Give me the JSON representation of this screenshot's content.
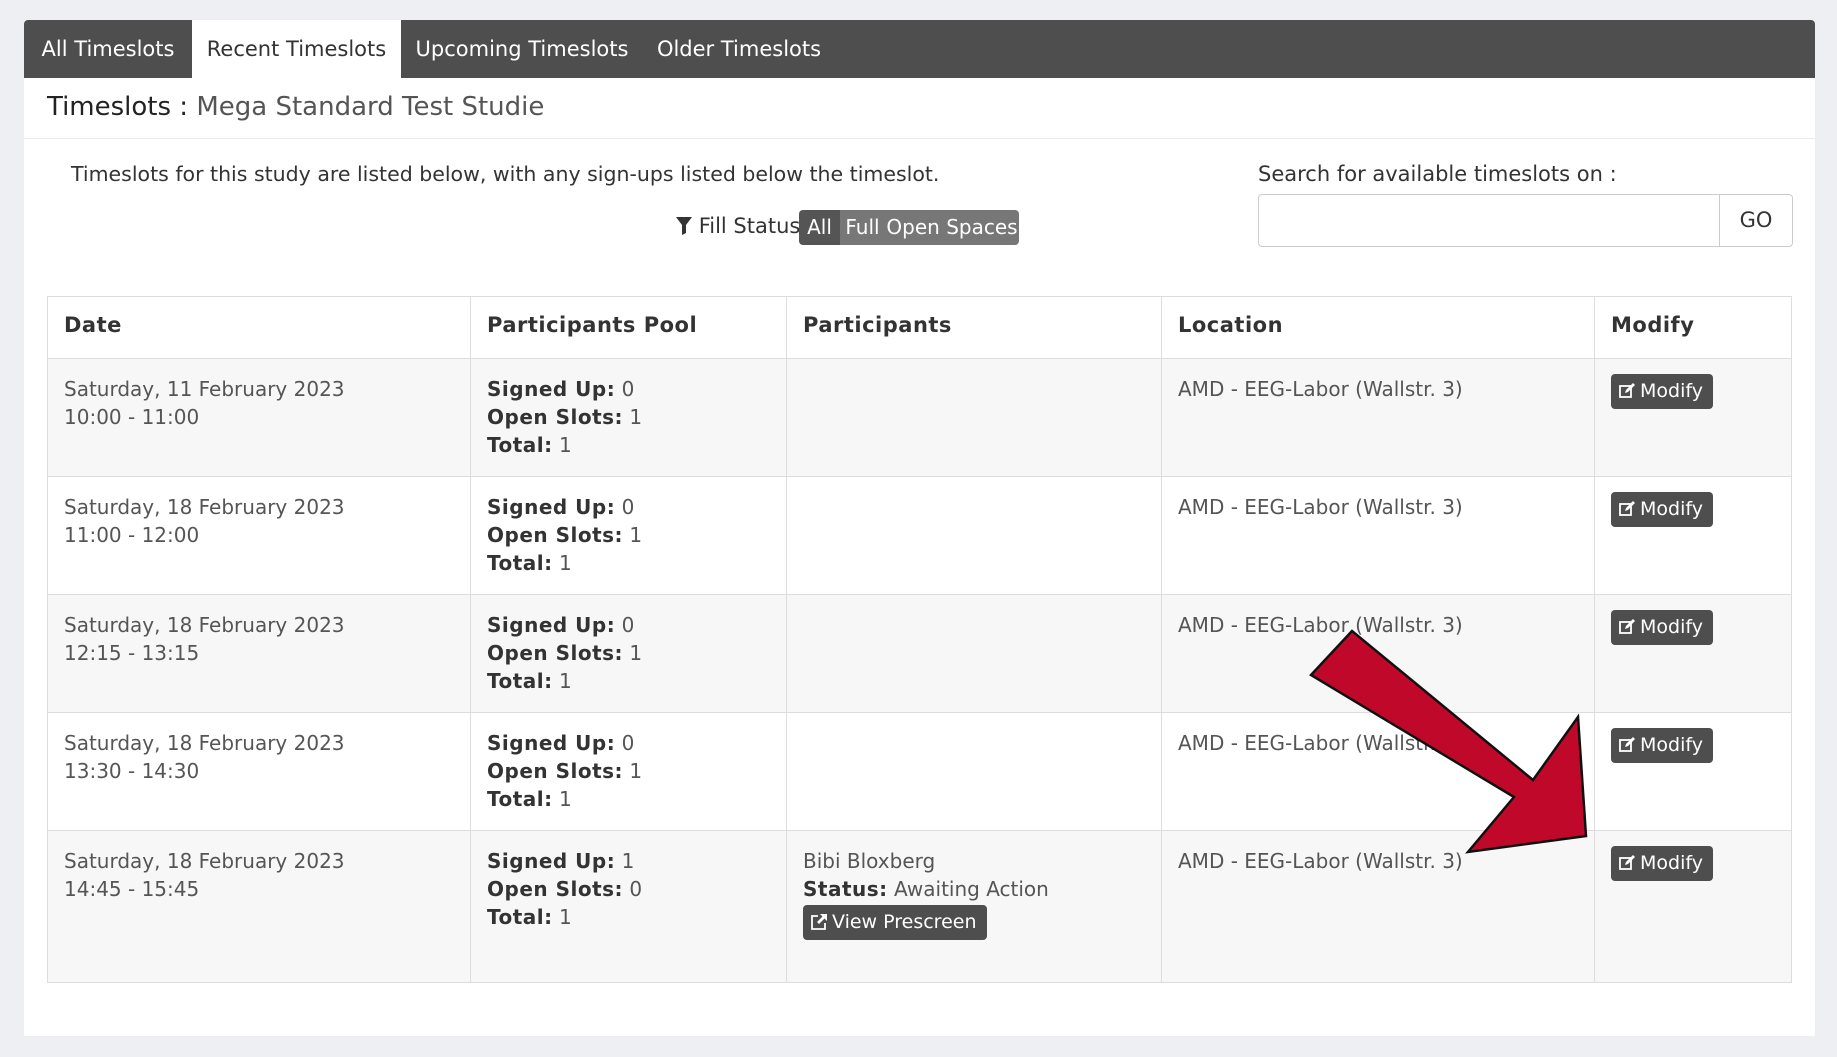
{
  "tabs": [
    {
      "label": "All Timeslots",
      "active": false
    },
    {
      "label": "Recent Timeslots",
      "active": true
    },
    {
      "label": "Upcoming Timeslots",
      "active": false
    },
    {
      "label": "Older Timeslots",
      "active": false
    }
  ],
  "page": {
    "title_prefix": "Timeslots :",
    "title_study": "Mega Standard Test Studie",
    "description": "Timeslots for this study are listed below, with any sign-ups listed below the timeslot."
  },
  "filter": {
    "label": "Fill Status",
    "options": [
      "All",
      "Full",
      "Open Spaces"
    ],
    "selected": "All"
  },
  "search": {
    "label": "Search for available timeslots on :",
    "value": "",
    "go_label": "GO"
  },
  "table": {
    "headers": [
      "Date",
      "Participants Pool",
      "Participants",
      "Location",
      "Modify"
    ],
    "labels": {
      "signed_up": "Signed Up:",
      "open_slots": "Open Slots:",
      "total": "Total:",
      "status": "Status:",
      "modify": "Modify",
      "view_prescreen": "View Prescreen"
    },
    "rows": [
      {
        "date": "Saturday, 11 February 2023",
        "time": "10:00 - 11:00",
        "signed_up": "0",
        "open_slots": "1",
        "total": "1",
        "participant_name": "",
        "participant_status": "",
        "location": "AMD - EEG-Labor (Wallstr. 3)"
      },
      {
        "date": "Saturday, 18 February 2023",
        "time": "11:00 - 12:00",
        "signed_up": "0",
        "open_slots": "1",
        "total": "1",
        "participant_name": "",
        "participant_status": "",
        "location": "AMD - EEG-Labor (Wallstr. 3)"
      },
      {
        "date": "Saturday, 18 February 2023",
        "time": "12:15 - 13:15",
        "signed_up": "0",
        "open_slots": "1",
        "total": "1",
        "participant_name": "",
        "participant_status": "",
        "location": "AMD - EEG-Labor (Wallstr. 3)"
      },
      {
        "date": "Saturday, 18 February 2023",
        "time": "13:30 - 14:30",
        "signed_up": "0",
        "open_slots": "1",
        "total": "1",
        "participant_name": "",
        "participant_status": "",
        "location": "AMD - EEG-Labor (Wallstr. 3)"
      },
      {
        "date": "Saturday, 18 February 2023",
        "time": "14:45 - 15:45",
        "signed_up": "1",
        "open_slots": "0",
        "total": "1",
        "participant_name": "Bibi Bloxberg",
        "participant_status": "Awaiting Action",
        "location": "AMD - EEG-Labor (Wallstr. 3)"
      }
    ]
  },
  "annotation": {
    "arrow_color": "#c0092a",
    "target": "modify-button-row-5"
  },
  "colors": {
    "tabbar": "#4e4e4e",
    "button": "#4e4e4e",
    "page_bg": "#eeeff3"
  }
}
